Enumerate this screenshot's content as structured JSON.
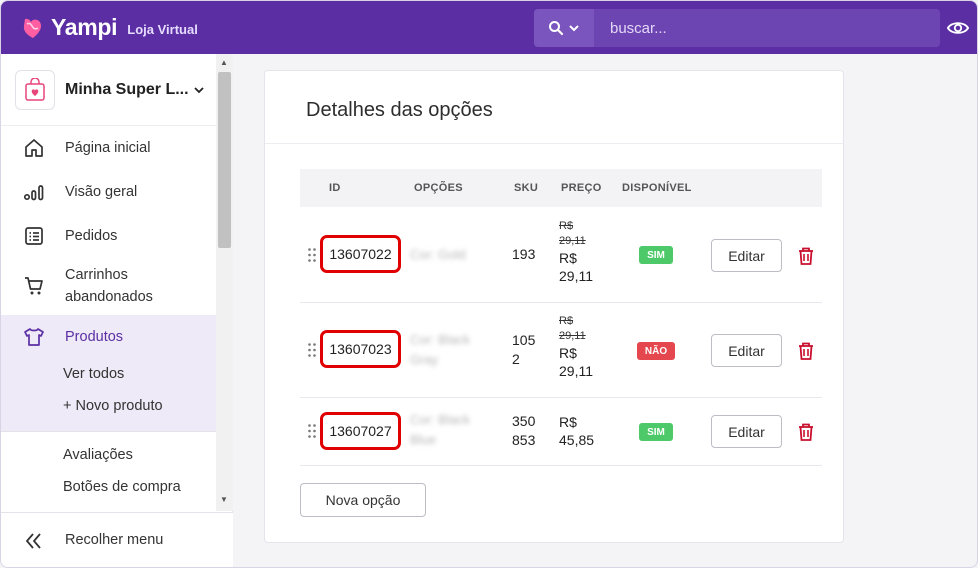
{
  "header": {
    "brand": "Yampi",
    "brand_sub": "Loja Virtual",
    "search_placeholder": "buscar..."
  },
  "sidebar": {
    "store_name": "Minha Super L...",
    "items": [
      {
        "label": "Página inicial",
        "icon": "home-icon"
      },
      {
        "label": "Visão geral",
        "icon": "bar-chart-icon"
      },
      {
        "label": "Pedidos",
        "icon": "list-icon"
      },
      {
        "label": "Carrinhos abandonados",
        "icon": "cart-icon"
      },
      {
        "label": "Produtos",
        "icon": "shirt-icon"
      }
    ],
    "sub_items": [
      "Ver todos",
      "+ Novo produto",
      "Avaliações",
      "Botões de compra"
    ],
    "collapse_label": "Recolher menu"
  },
  "card": {
    "title": "Detalhes das opções",
    "columns": [
      "ID",
      "OPÇÕES",
      "SKU",
      "PREÇO",
      "DISPONÍVEL"
    ],
    "rows": [
      {
        "id": "13607022",
        "option": "Cor: Gold",
        "sku": "193",
        "old_price": "R$ 29,11",
        "price": "R$ 29,11",
        "available": "SIM"
      },
      {
        "id": "13607023",
        "option": "Cor: Black Gray",
        "sku": "1052",
        "old_price": "R$ 29,11",
        "price": "R$ 29,11",
        "available": "NÃO"
      },
      {
        "id": "13607027",
        "option": "Cor: Black Blue",
        "sku": "350853",
        "old_price": "",
        "price": "R$ 45,85",
        "available": "SIM"
      }
    ],
    "edit_label": "Editar",
    "add_label": "Nova opção"
  },
  "colors": {
    "brand": "#5b2fa3",
    "available_yes": "#4dc96a",
    "available_no": "#e4474d",
    "delete": "#c8102e",
    "highlight": "#e00000"
  }
}
